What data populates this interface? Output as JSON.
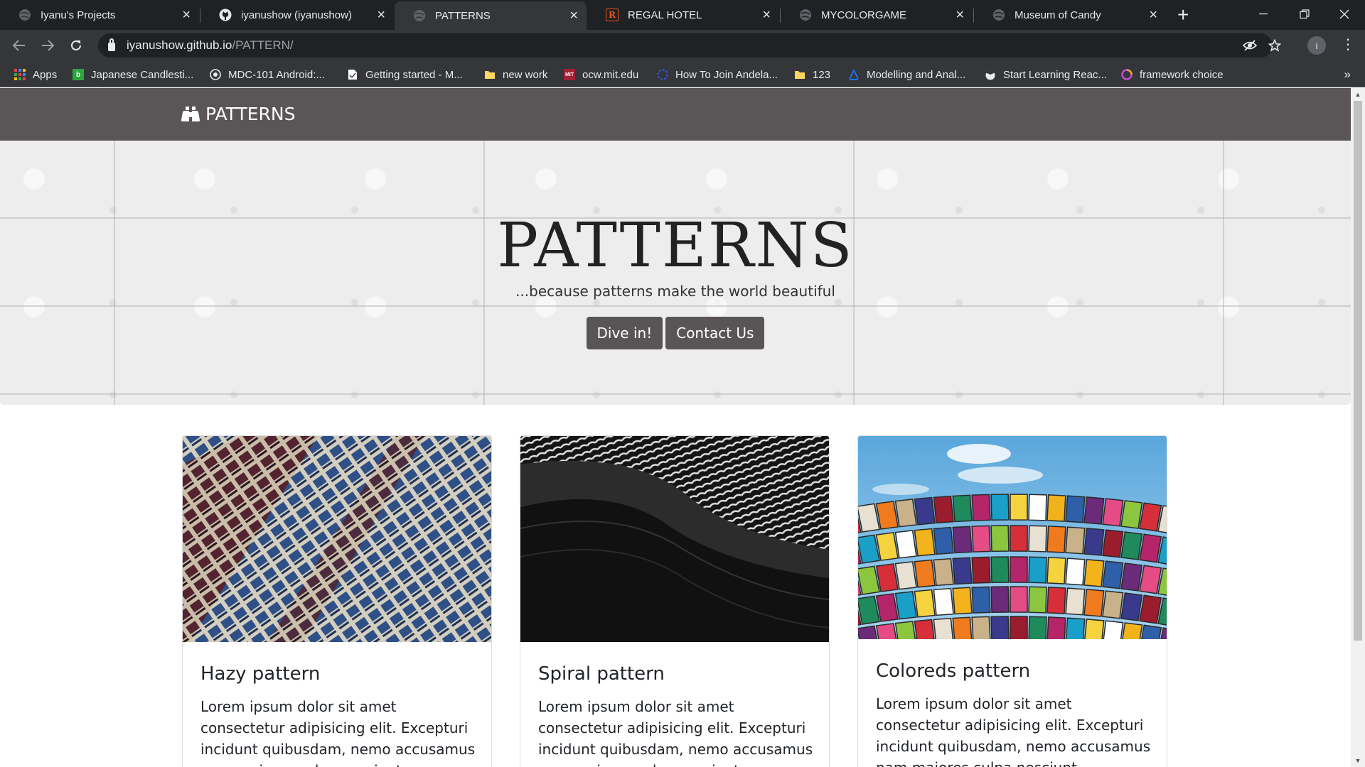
{
  "browser": {
    "tabs": [
      {
        "title": "Iyanu's Projects",
        "icon": "globe-icon",
        "active": false
      },
      {
        "title": "iyanushow (iyanushow)",
        "icon": "github-icon",
        "active": false
      },
      {
        "title": "PATTERNS",
        "icon": "globe-icon",
        "active": true
      },
      {
        "title": "REGAL HOTEL",
        "icon": "regal-r-icon",
        "active": false
      },
      {
        "title": "MYCOLORGAME",
        "icon": "globe-icon",
        "active": false
      },
      {
        "title": "Museum of Candy",
        "icon": "globe-icon",
        "active": false
      }
    ],
    "url_host": "iyanushow.github.io",
    "url_path": "/PATTERN/",
    "profile_initial": "i",
    "bookmarks": [
      {
        "label": "Apps",
        "icon": "apps-grid-icon"
      },
      {
        "label": "Japanese Candlesti...",
        "icon": "b-green-icon"
      },
      {
        "label": "MDC-101 Android:...",
        "icon": "target-icon"
      },
      {
        "label": "Getting started - M...",
        "icon": "page-icon"
      },
      {
        "label": "new work",
        "icon": "folder-icon"
      },
      {
        "label": "ocw.mit.edu",
        "icon": "mit-icon"
      },
      {
        "label": "How To Join Andela...",
        "icon": "andela-icon"
      },
      {
        "label": "123",
        "icon": "folder-icon"
      },
      {
        "label": "Modelling and Anal...",
        "icon": "blue-a-icon"
      },
      {
        "label": "Start Learning Reac...",
        "icon": "globe-cap-icon"
      },
      {
        "label": "framework choice",
        "icon": "circle-gradient-icon"
      }
    ]
  },
  "site": {
    "brand": "PATTERNS",
    "hero": {
      "title": "PATTERNS",
      "subtitle": "...because patterns make the world beautiful",
      "primary_button": "Dive in!",
      "secondary_button": "Contact Us"
    },
    "cards": [
      {
        "title": "Hazy pattern",
        "text": "Lorem ipsum dolor sit amet consectetur adipisicing elit. Excepturi incidunt quibusdam, nemo accusamus nam maiores culpa nesciunt architecto corporis, modi"
      },
      {
        "title": "Spiral pattern",
        "text": "Lorem ipsum dolor sit amet consectetur adipisicing elit. Excepturi incidunt quibusdam, nemo accusamus nam maiores culpa nesciunt architecto corporis, modi"
      },
      {
        "title": "Coloreds pattern",
        "text": "Lorem ipsum dolor sit amet consectetur adipisicing elit. Excepturi incidunt quibusdam, nemo accusamus nam maiores culpa nesciunt architecto corporis, modi"
      }
    ]
  }
}
